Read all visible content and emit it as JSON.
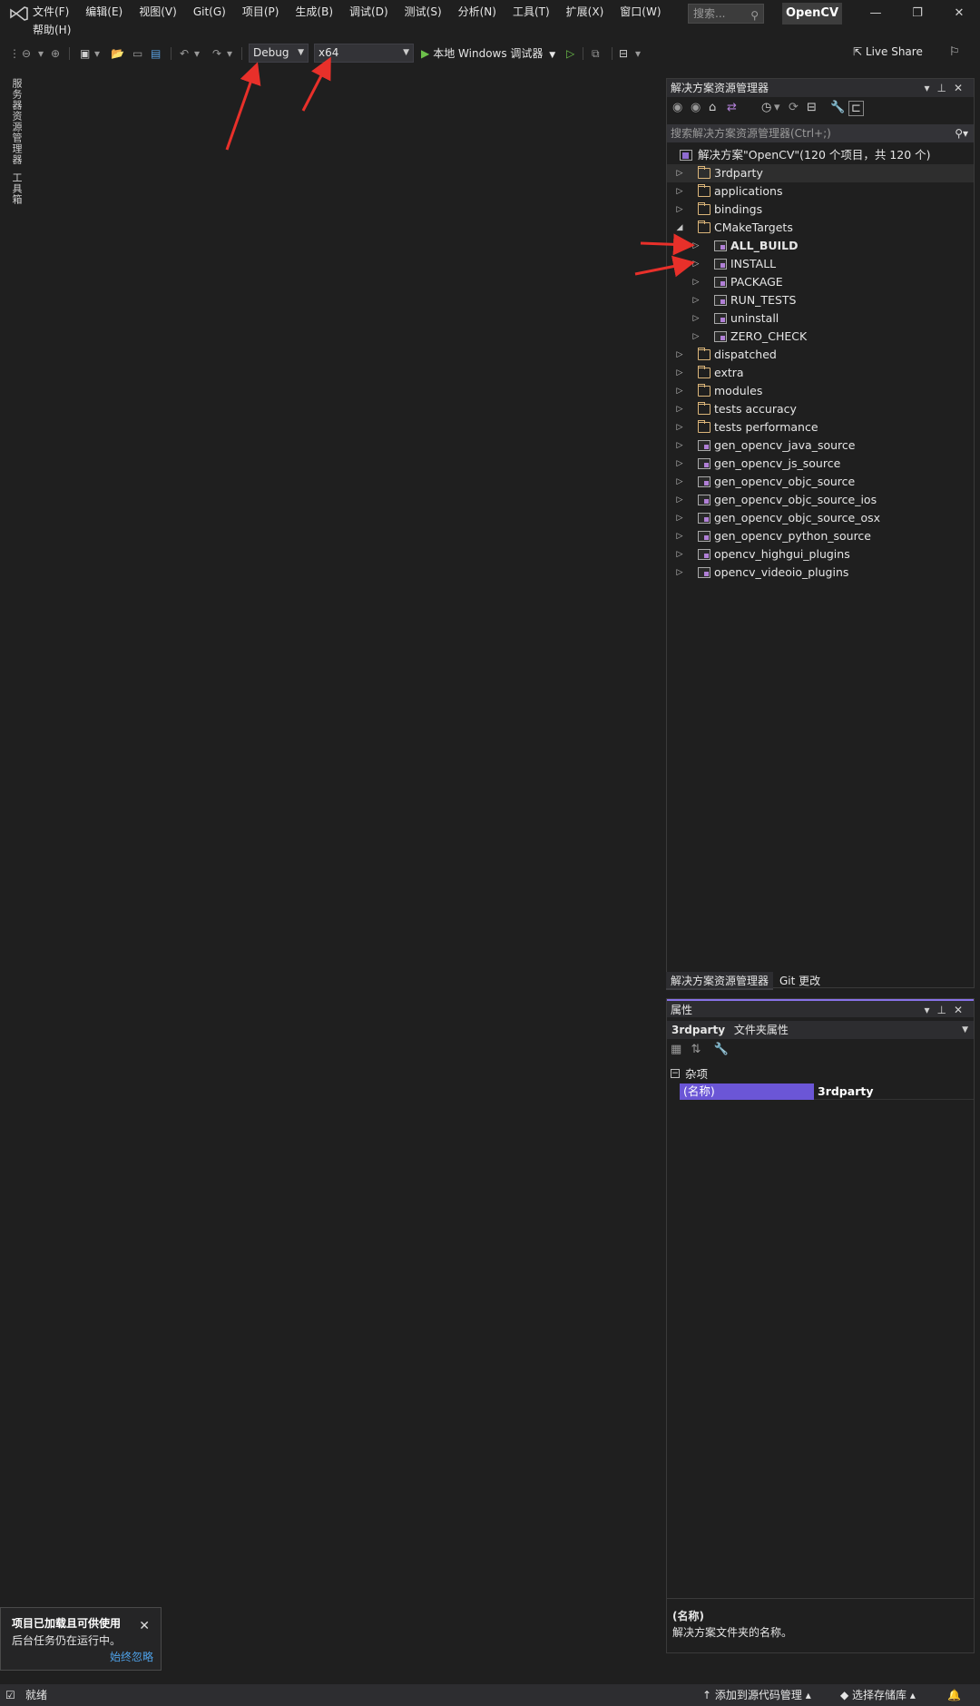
{
  "menu": {
    "items": [
      "文件(F)",
      "编辑(E)",
      "视图(V)",
      "Git(G)",
      "项目(P)",
      "生成(B)",
      "调试(D)",
      "测试(S)",
      "分析(N)",
      "工具(T)",
      "扩展(X)",
      "窗口(W)"
    ],
    "help": "帮助(H)",
    "search_placeholder": "搜索...",
    "project_name": "OpenCV"
  },
  "toolbar": {
    "config": "Debug",
    "platform": "x64",
    "run_label": "本地 Windows 调试器",
    "live_share": "Live Share"
  },
  "left_tabs": [
    "服务器资源管理器",
    "工具箱"
  ],
  "solution_explorer": {
    "title": "解决方案资源管理器",
    "search_placeholder": "搜索解决方案资源管理器(Ctrl+;)",
    "solution_label": "解决方案\"OpenCV\"(120 个项目，共 120 个)",
    "items": [
      {
        "label": "3rdparty",
        "type": "folder",
        "level": 1,
        "selected": true
      },
      {
        "label": "applications",
        "type": "folder",
        "level": 1
      },
      {
        "label": "bindings",
        "type": "folder",
        "level": 1
      },
      {
        "label": "CMakeTargets",
        "type": "folder",
        "level": 1,
        "expanded": true
      },
      {
        "label": "ALL_BUILD",
        "type": "project",
        "level": 2,
        "bold": true
      },
      {
        "label": "INSTALL",
        "type": "project",
        "level": 2
      },
      {
        "label": "PACKAGE",
        "type": "project",
        "level": 2
      },
      {
        "label": "RUN_TESTS",
        "type": "project",
        "level": 2
      },
      {
        "label": "uninstall",
        "type": "project",
        "level": 2
      },
      {
        "label": "ZERO_CHECK",
        "type": "project",
        "level": 2
      },
      {
        "label": "dispatched",
        "type": "folder",
        "level": 1
      },
      {
        "label": "extra",
        "type": "folder",
        "level": 1
      },
      {
        "label": "modules",
        "type": "folder",
        "level": 1
      },
      {
        "label": "tests accuracy",
        "type": "folder",
        "level": 1
      },
      {
        "label": "tests performance",
        "type": "folder",
        "level": 1
      },
      {
        "label": "gen_opencv_java_source",
        "type": "project",
        "level": 1
      },
      {
        "label": "gen_opencv_js_source",
        "type": "project",
        "level": 1
      },
      {
        "label": "gen_opencv_objc_source",
        "type": "project",
        "level": 1
      },
      {
        "label": "gen_opencv_objc_source_ios",
        "type": "project",
        "level": 1
      },
      {
        "label": "gen_opencv_objc_source_osx",
        "type": "project",
        "level": 1
      },
      {
        "label": "gen_opencv_python_source",
        "type": "project",
        "level": 1
      },
      {
        "label": "opencv_highgui_plugins",
        "type": "project",
        "level": 1
      },
      {
        "label": "opencv_videoio_plugins",
        "type": "project",
        "level": 1
      }
    ],
    "bottom_tabs": [
      "解决方案资源管理器",
      "Git 更改"
    ]
  },
  "properties": {
    "title": "属性",
    "object_name": "3rdparty",
    "object_type": "文件夹属性",
    "category": "杂项",
    "rows": [
      {
        "name": "(名称)",
        "value": "3rdparty"
      }
    ],
    "desc_title": "(名称)",
    "desc_body": "解决方案文件夹的名称。"
  },
  "notification": {
    "title": "项目已加载且可供使用",
    "body": "后台任务仍在运行中。",
    "link": "始终忽略"
  },
  "statusbar": {
    "ready": "就绪",
    "source_control": "添加到源代码管理",
    "repo": "选择存储库"
  },
  "colors": {
    "background": "#1f1f1f",
    "accent": "#6b56d6",
    "annotation_arrow": "#e8302a"
  }
}
